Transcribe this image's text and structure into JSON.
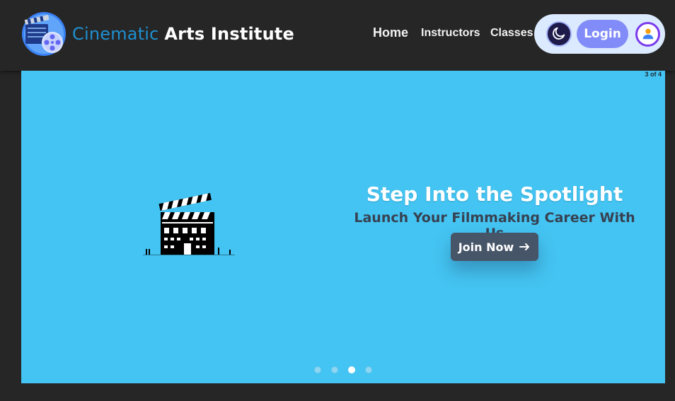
{
  "brand": {
    "name_part1": "Cinematic",
    "name_part2": "Arts Institute",
    "logo_icon": "film-reel-clapper-icon"
  },
  "nav": {
    "home": "Home",
    "instructors": "Instructors",
    "classes": "Classes"
  },
  "actions": {
    "theme_icon": "moon-icon",
    "login_label": "Login",
    "avatar_icon": "user-icon"
  },
  "hero": {
    "slide_counter": "3 of 4",
    "title": "Step Into the Spotlight",
    "subtitle": "Launch Your Filmmaking Career With Us",
    "cta_label": "Join Now",
    "cta_icon": "arrow-right-icon",
    "illustration_icon": "clapperboard-building-icon",
    "current_slide": 3,
    "total_slides": 4
  },
  "colors": {
    "accent_blue": "#1f8fd0",
    "hero_bg": "#44c4f2",
    "login_bg": "#818cf8",
    "cta_bg": "#475569"
  }
}
